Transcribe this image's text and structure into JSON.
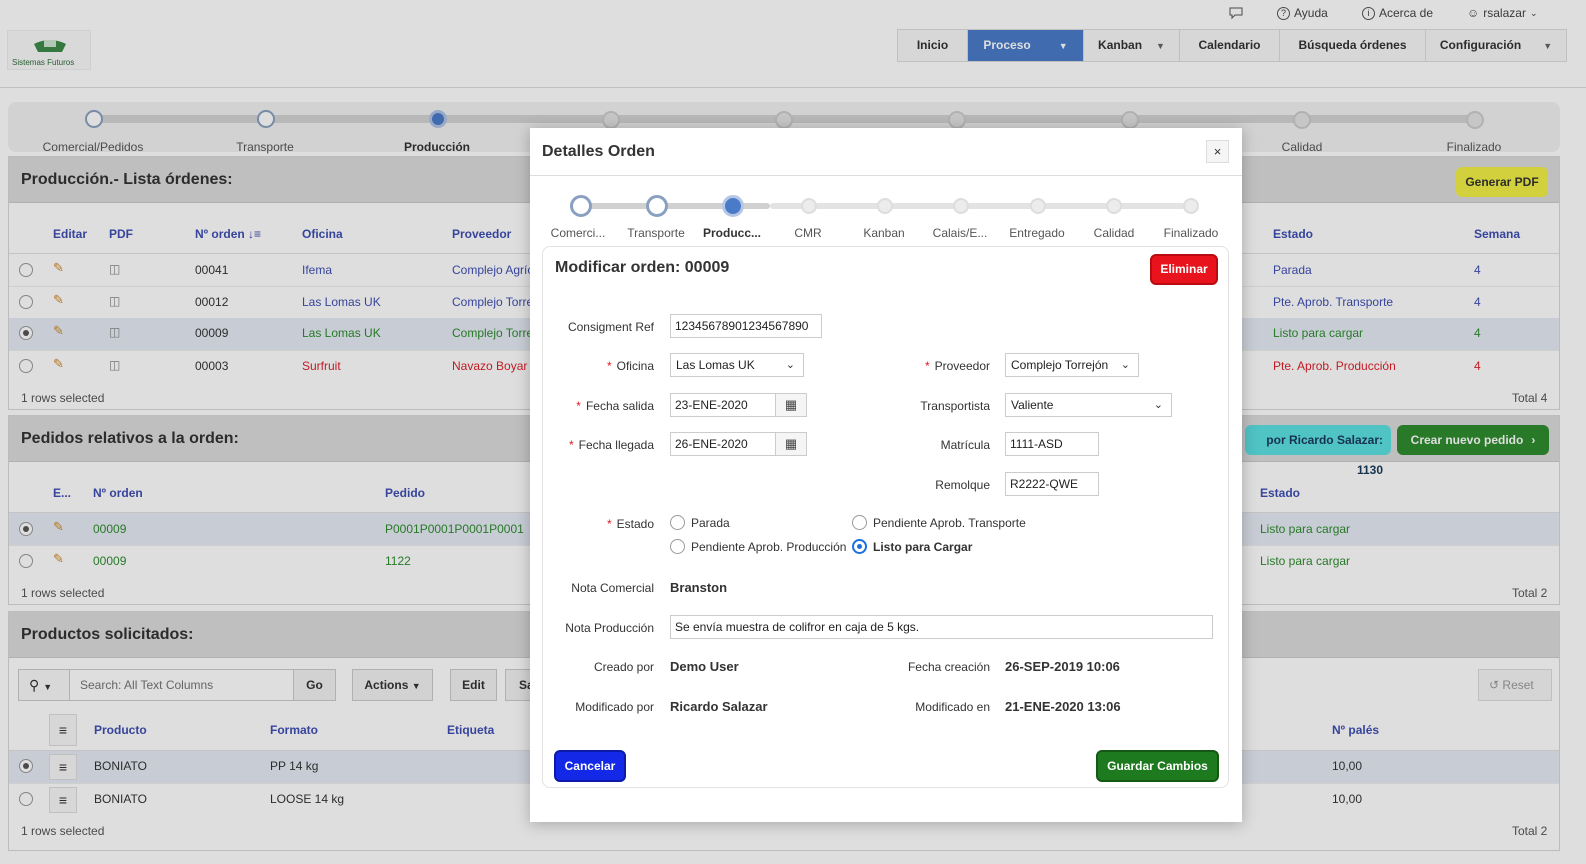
{
  "header": {
    "logo_text": "Sistemas Futuros",
    "help": "Ayuda",
    "about": "Acerca de",
    "user": "rsalazar",
    "nav": [
      "Inicio",
      "Proceso",
      "Kanban",
      "Calendario",
      "Búsqueda órdenes",
      "Configuración"
    ]
  },
  "process_steps": [
    "Comercial/Pedidos",
    "Transporte",
    "Producción",
    "",
    "",
    "",
    "",
    "Calidad",
    "Finalizado"
  ],
  "orders_region": {
    "title": "Producción.- Lista órdenes:",
    "generate_pdf": "Generar PDF",
    "columns": [
      "Editar",
      "PDF",
      "Nº orden ↓≡",
      "Oficina",
      "Proveedor",
      "Estado",
      "Semana"
    ],
    "rows": [
      {
        "order": "00041",
        "office": "Ifema",
        "supplier": "Complejo Agríc",
        "status": "Parada",
        "week": "4"
      },
      {
        "order": "00012",
        "office": "Las Lomas UK",
        "supplier": "Complejo Torre",
        "status": "Pte. Aprob. Transporte",
        "week": "4"
      },
      {
        "order": "00009",
        "office": "Las Lomas UK",
        "supplier": "Complejo Torre",
        "status": "Listo para cargar",
        "week": "4"
      },
      {
        "order": "00003",
        "office": "Surfruit",
        "supplier": "Navazo Boyar",
        "status": "Pte. Aprob. Producción",
        "week": "4"
      }
    ],
    "selected": "1 rows selected",
    "total": "Total 4"
  },
  "related_region": {
    "title": "Pedidos relativos a la orden:",
    "badge": "por Ricardo Salazar: 1130",
    "new_order": "Crear nuevo pedido",
    "columns": [
      "E...",
      "Nº orden",
      "Pedido",
      "Estado"
    ],
    "rows": [
      {
        "order": "00009",
        "pedido": "P0001P0001P0001P0001",
        "status": "Listo para cargar"
      },
      {
        "order": "00009",
        "pedido": "1122",
        "status": "Listo para cargar"
      }
    ],
    "selected": "1 rows selected",
    "total": "Total 2"
  },
  "products_region": {
    "title": "Productos solicitados:",
    "search_placeholder": "Search: All Text Columns",
    "go": "Go",
    "actions": "Actions",
    "edit": "Edit",
    "save_short": "Sa",
    "reset": "Reset",
    "columns": [
      "Producto",
      "Formato",
      "Etiqueta",
      "Nº palés"
    ],
    "rows": [
      {
        "product": "BONIATO",
        "format": "PP 14 kg",
        "pallets": "10,00"
      },
      {
        "product": "BONIATO",
        "format": "LOOSE 14 kg",
        "pallets": "10,00"
      }
    ],
    "selected": "1 rows selected",
    "total": "Total 2"
  },
  "modal": {
    "title": "Detalles Orden",
    "close": "×",
    "steps": [
      "Comerci...",
      "Transporte",
      "Producc...",
      "CMR",
      "Kanban",
      "Calais/E...",
      "Entregado",
      "Calidad",
      "Finalizado"
    ],
    "subtitle": "Modificar orden: 00009",
    "delete": "Eliminar",
    "consignment_label": "Consigment Ref",
    "consignment_value": "12345678901234567890",
    "office_label": "Oficina",
    "office_value": "Las Lomas UK",
    "supplier_label": "Proveedor",
    "supplier_value": "Complejo Torrejón",
    "departure_label": "Fecha salida",
    "departure_value": "23-ENE-2020",
    "carrier_label": "Transportista",
    "carrier_value": "Valiente",
    "arrival_label": "Fecha llegada",
    "arrival_value": "26-ENE-2020",
    "plate_label": "Matrícula",
    "plate_value": "1111-ASD",
    "trailer_label": "Remolque",
    "trailer_value": "R2222-QWE",
    "status_label": "Estado",
    "status_options": [
      "Parada",
      "Pendiente Aprob. Transporte",
      "Pendiente Aprob. Producción",
      "Listo para Cargar"
    ],
    "status_selected": "Listo para Cargar",
    "commercial_note_label": "Nota Comercial",
    "commercial_note_value": "Branston",
    "production_note_label": "Nota Producción",
    "production_note_value": "Se envía muestra de colifror en caja de 5 kgs.",
    "created_by_label": "Creado por",
    "created_by_value": "Demo User",
    "created_at_label": "Fecha creación",
    "created_at_value": "26-SEP-2019 10:06",
    "modified_by_label": "Modificado por",
    "modified_by_value": "Ricardo Salazar",
    "modified_at_label": "Modificado en",
    "modified_at_value": "21-ENE-2020 13:06",
    "cancel": "Cancelar",
    "save": "Guardar Cambios"
  },
  "colors": {
    "primary": "#4a7bc8",
    "danger": "#e8131d",
    "success": "#1e7a1e",
    "cancel": "#1429e8",
    "link": "#3f4fb3",
    "green_text": "#2e8b2e",
    "red_text": "#e0212a"
  }
}
